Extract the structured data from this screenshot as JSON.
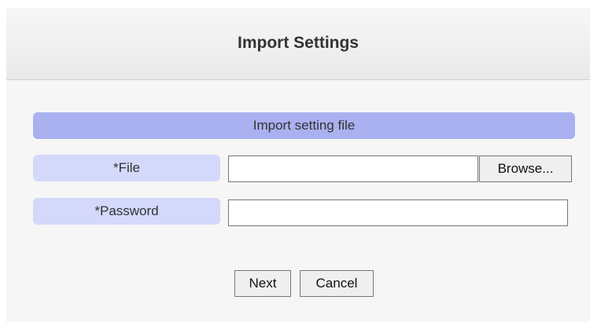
{
  "header": {
    "title": "Import Settings"
  },
  "form": {
    "section_title": "Import setting file",
    "file": {
      "label": "*File",
      "value": "",
      "browse_label": "Browse..."
    },
    "password": {
      "label": "*Password",
      "value": ""
    }
  },
  "actions": {
    "next_label": "Next",
    "cancel_label": "Cancel"
  },
  "colors": {
    "section_header": "#aab1f1",
    "row_label": "#d4d8fa",
    "background": "#f6f6f6"
  }
}
